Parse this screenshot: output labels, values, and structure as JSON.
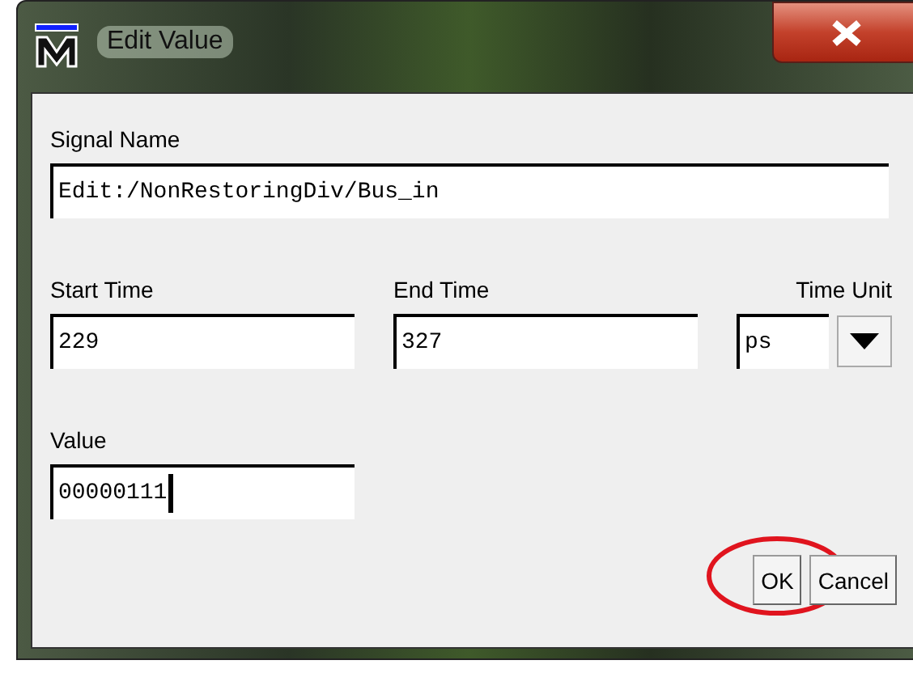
{
  "window": {
    "title": "Edit Value"
  },
  "signal": {
    "label": "Signal Name",
    "value": "Edit:/NonRestoringDiv/Bus_in",
    "focused": false
  },
  "times": [
    {
      "label": "Start Time",
      "value": "229",
      "focused": false
    },
    {
      "label": "End Time",
      "value": "327",
      "focused": false
    }
  ],
  "time_unit": {
    "label": "Time Unit",
    "value": "ps"
  },
  "value": {
    "label": "Value",
    "value": "00000111",
    "focused": true
  },
  "buttons": [
    {
      "label": "OK",
      "circled": true
    },
    {
      "label": "Cancel",
      "circled": false
    }
  ]
}
